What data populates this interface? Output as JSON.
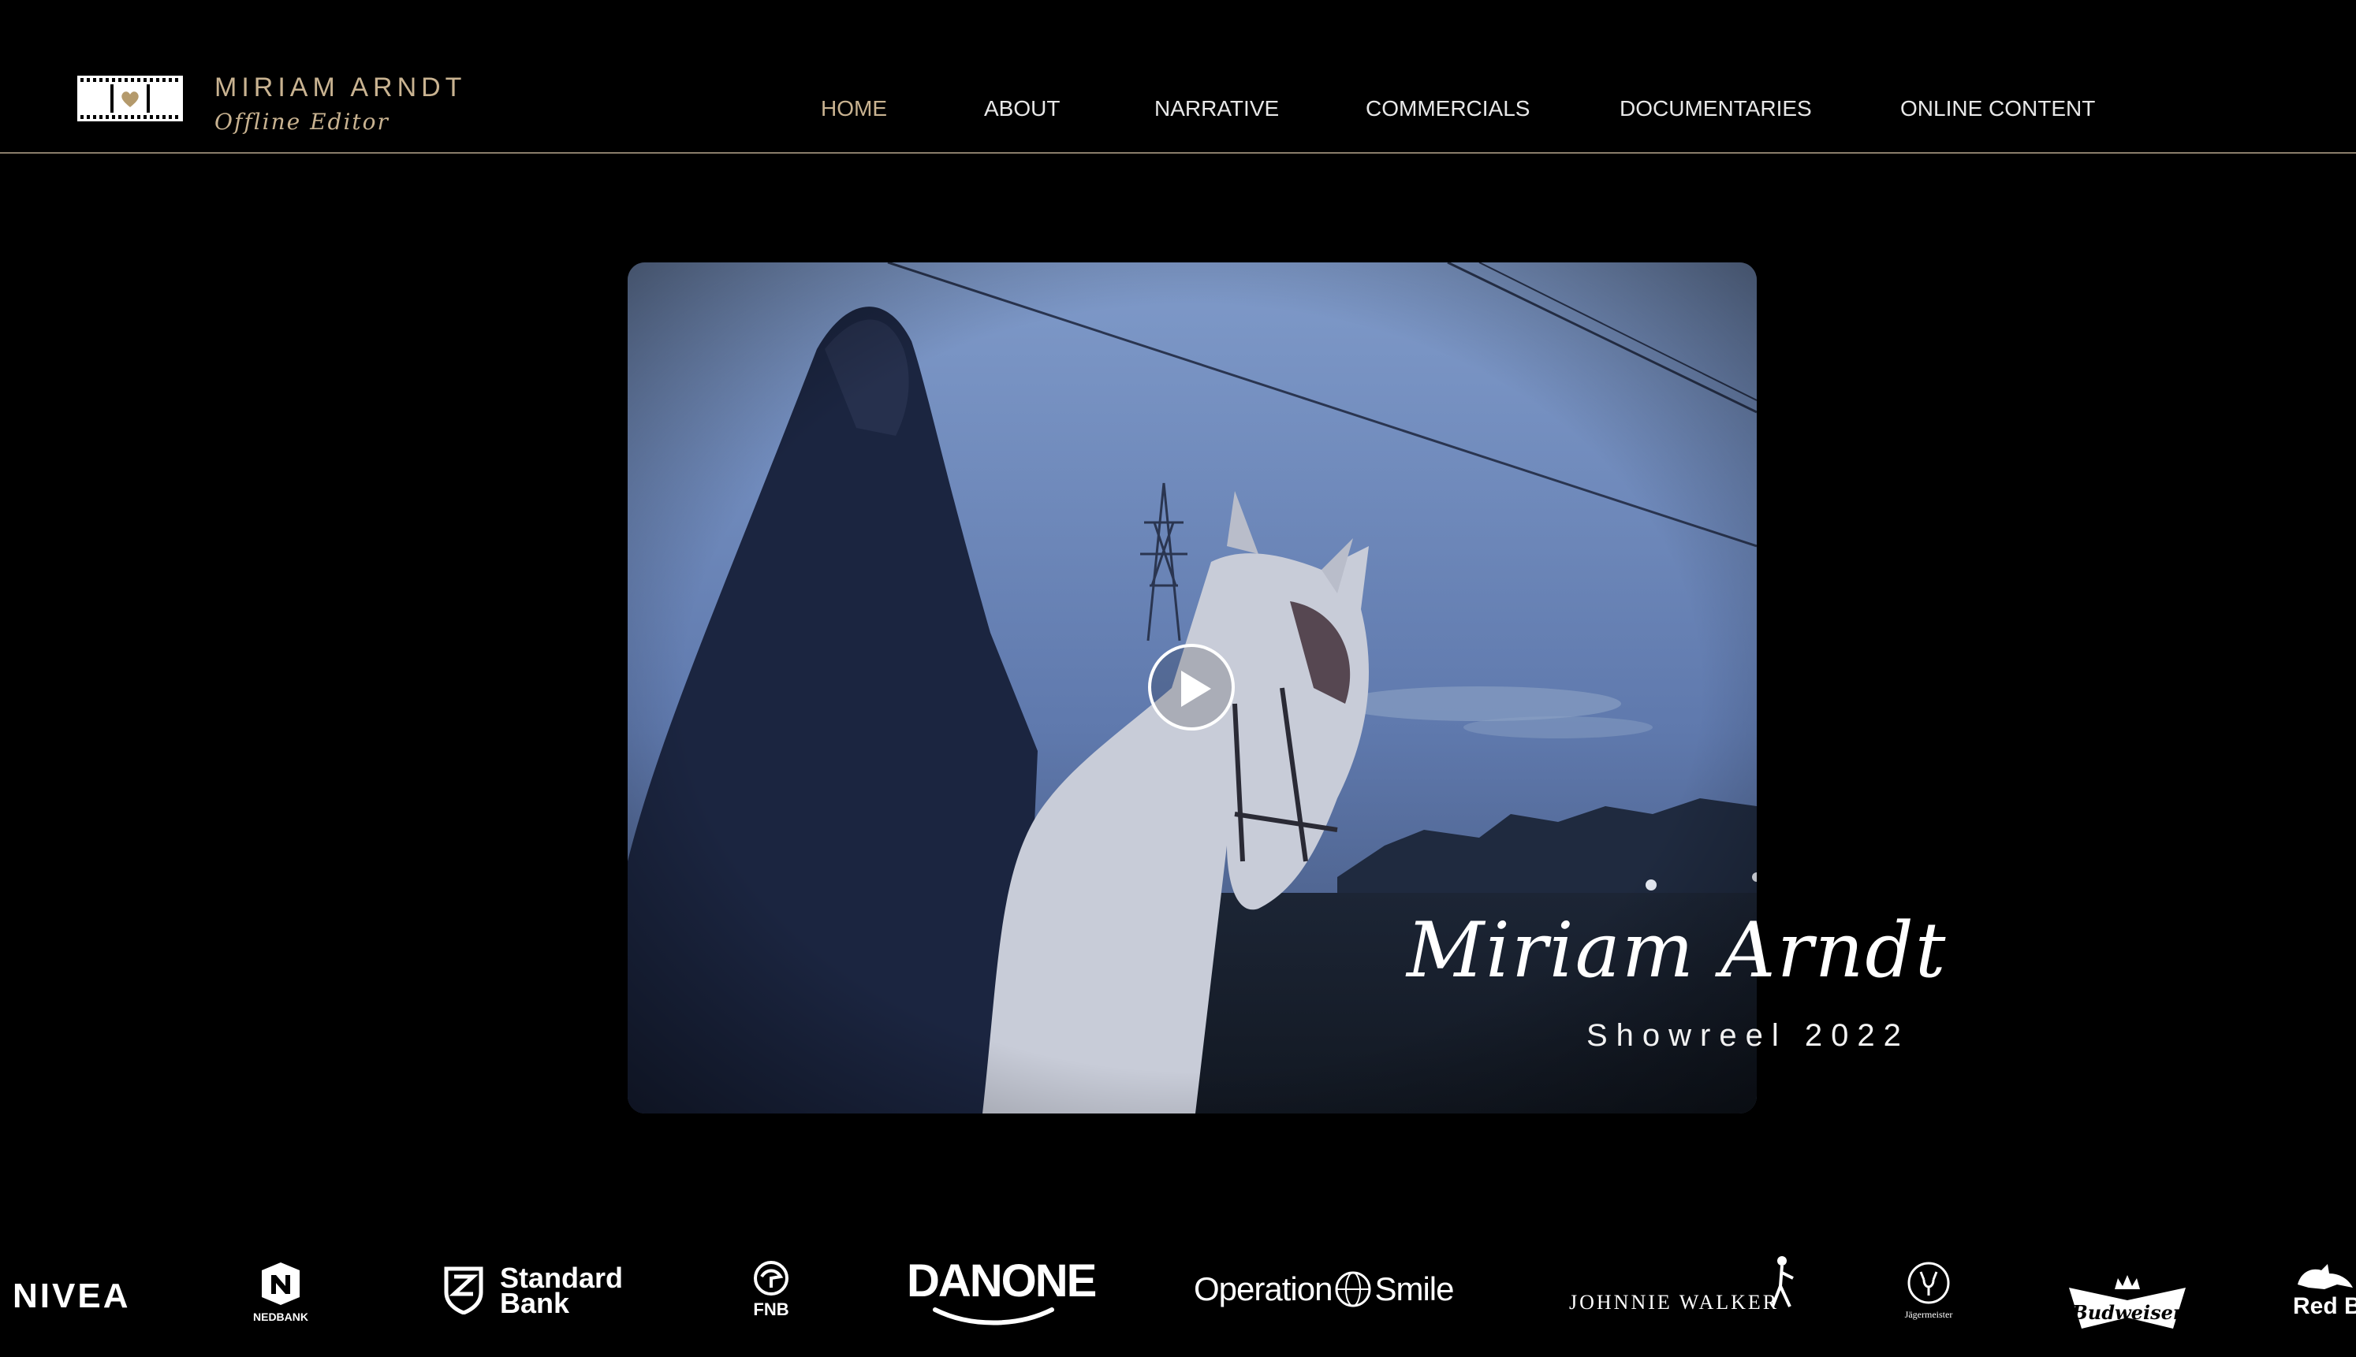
{
  "brand": {
    "name": "MIRIAM ARNDT",
    "tagline": "Offline Editor",
    "logo_icon": "film-strip-heart-icon"
  },
  "nav": {
    "items": [
      {
        "label": "HOME",
        "active": true
      },
      {
        "label": "ABOUT",
        "active": false
      },
      {
        "label": "NARRATIVE",
        "active": false
      },
      {
        "label": "COMMERCIALS",
        "active": false
      },
      {
        "label": "DOCUMENTARIES",
        "active": false
      },
      {
        "label": "ONLINE CONTENT",
        "active": false
      }
    ]
  },
  "hero": {
    "play_icon": "play-icon",
    "signature": "Miriam Arndt",
    "subtitle": "Showreel 2022"
  },
  "clients": {
    "nivea": "NIVEA",
    "nedbank": "NEDBANK",
    "standard_bank_line1": "Standard",
    "standard_bank_line2": "Bank",
    "fnb": "FNB",
    "danone": "DANONE",
    "operation_smile_a": "Operation",
    "operation_smile_b": "Smile",
    "johnnie_walker": "JOHNNIE WALKER",
    "jagermeister": "Jägermeister",
    "budweiser": "Budweiser",
    "red_bull": "Red B"
  },
  "colors": {
    "accent_gold": "#c9b391",
    "background": "#000000"
  }
}
